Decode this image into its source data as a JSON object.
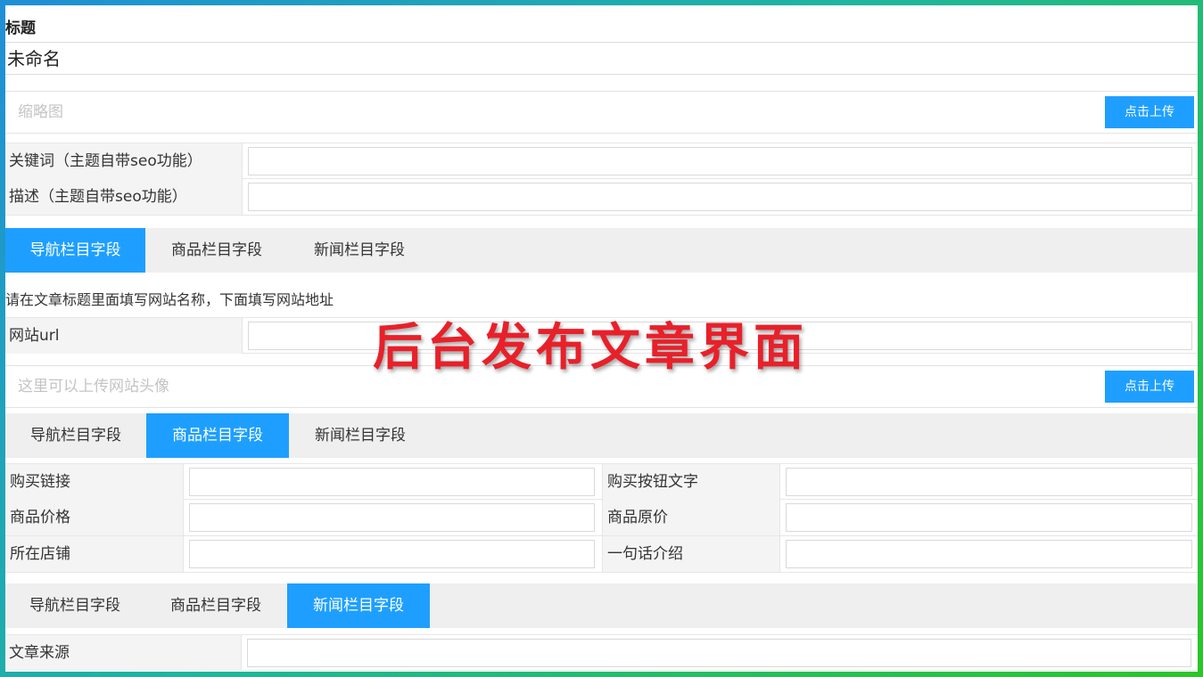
{
  "title": {
    "label": "标题",
    "value": "未命名"
  },
  "thumbnail": {
    "placeholder": "缩略图",
    "upload_label": "点击上传"
  },
  "seo": {
    "keywords_label": "关键词（主题自带seo功能）",
    "description_label": "描述（主题自带seo功能）"
  },
  "tabs1": {
    "items": [
      "导航栏目字段",
      "商品栏目字段",
      "新闻栏目字段"
    ],
    "active": "导航栏目字段"
  },
  "nav_fields": {
    "hint": "请在文章标题里面填写网站名称，下面填写网站地址",
    "url_label": "网站url",
    "avatar_placeholder": "这里可以上传网站头像",
    "upload_label": "点击上传"
  },
  "tabs2": {
    "items": [
      "导航栏目字段",
      "商品栏目字段",
      "新闻栏目字段"
    ],
    "active": "商品栏目字段"
  },
  "product_fields": {
    "buy_link": "购买链接",
    "buy_button_text": "购买按钮文字",
    "price": "商品价格",
    "original_price": "商品原价",
    "shop": "所在店铺",
    "intro": "一句话介绍"
  },
  "tabs3": {
    "items": [
      "导航栏目字段",
      "商品栏目字段",
      "新闻栏目字段"
    ],
    "active": "新闻栏目字段"
  },
  "news_fields": {
    "source_label": "文章来源"
  },
  "watermark": "后台发布文章界面",
  "colors": {
    "accent": "#1e9fff",
    "watermark": "#e8202a",
    "frame": "#2cc52a"
  }
}
